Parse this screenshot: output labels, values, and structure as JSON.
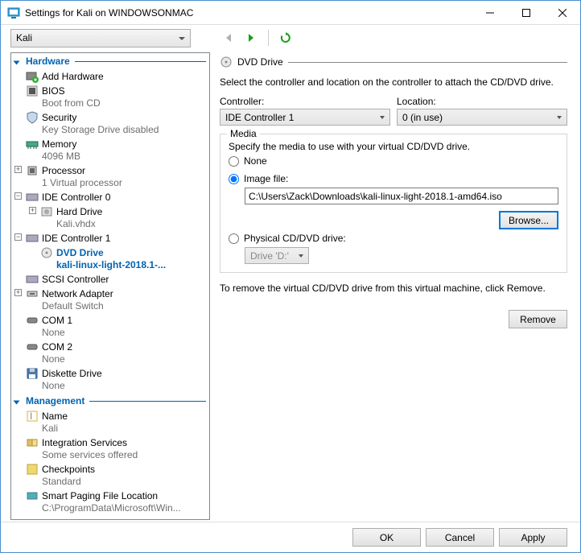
{
  "window": {
    "title": "Settings for Kali on WINDOWSONMAC"
  },
  "toolbar": {
    "vm": "Kali"
  },
  "sections": {
    "hardware": "Hardware",
    "management": "Management"
  },
  "tree": {
    "addhw": "Add Hardware",
    "bios": "BIOS",
    "bios_sub": "Boot from CD",
    "security": "Security",
    "security_sub": "Key Storage Drive disabled",
    "memory": "Memory",
    "memory_sub": "4096 MB",
    "processor": "Processor",
    "processor_sub": "1 Virtual processor",
    "ide0": "IDE Controller 0",
    "hdd": "Hard Drive",
    "hdd_sub": "Kali.vhdx",
    "ide1": "IDE Controller 1",
    "dvd": "DVD Drive",
    "dvd_sub": "kali-linux-light-2018.1-...",
    "scsi": "SCSI Controller",
    "net": "Network Adapter",
    "net_sub": "Default Switch",
    "com1": "COM 1",
    "com1_sub": "None",
    "com2": "COM 2",
    "com2_sub": "None",
    "diskette": "Diskette Drive",
    "diskette_sub": "None",
    "name": "Name",
    "name_sub": "Kali",
    "integ": "Integration Services",
    "integ_sub": "Some services offered",
    "check": "Checkpoints",
    "check_sub": "Standard",
    "smart": "Smart Paging File Location",
    "smart_sub": "C:\\ProgramData\\Microsoft\\Win..."
  },
  "right": {
    "heading": "DVD Drive",
    "desc": "Select the controller and location on the controller to attach the CD/DVD drive.",
    "controller_label": "Controller:",
    "controller_value": "IDE Controller 1",
    "location_label": "Location:",
    "location_value": "0 (in use)",
    "media_label": "Media",
    "media_desc": "Specify the media to use with your virtual CD/DVD drive.",
    "radio_none": "None",
    "radio_image": "Image file:",
    "image_path": "C:\\Users\\Zack\\Downloads\\kali-linux-light-2018.1-amd64.iso",
    "browse": "Browse...",
    "radio_physical": "Physical CD/DVD drive:",
    "physical_value": "Drive 'D:'",
    "remove_desc": "To remove the virtual CD/DVD drive from this virtual machine, click Remove.",
    "remove": "Remove"
  },
  "footer": {
    "ok": "OK",
    "cancel": "Cancel",
    "apply": "Apply"
  }
}
